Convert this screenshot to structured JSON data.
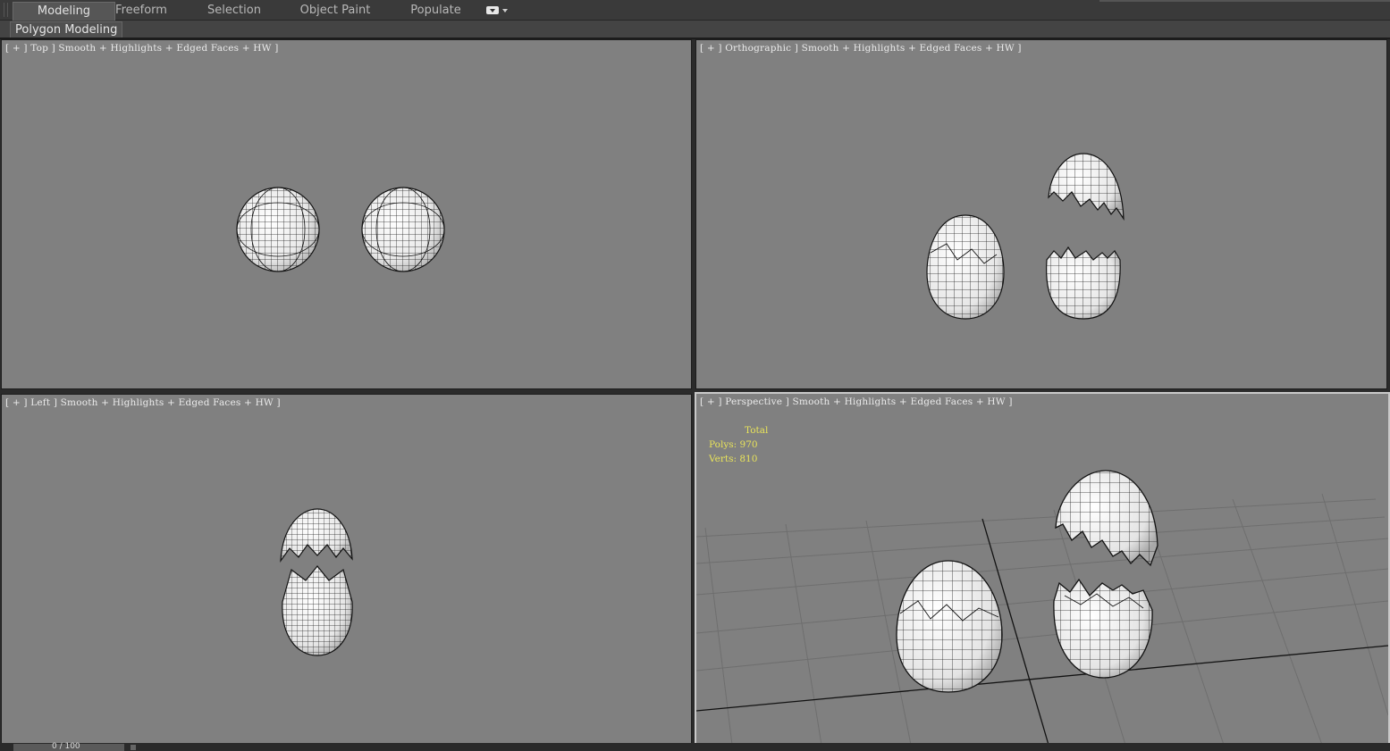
{
  "ribbon": {
    "tabs": [
      {
        "label": "Modeling",
        "active": true
      },
      {
        "label": "Freeform",
        "active": false
      },
      {
        "label": "Selection",
        "active": false
      },
      {
        "label": "Object Paint",
        "active": false
      },
      {
        "label": "Populate",
        "active": false
      }
    ],
    "dropdown_icon": "panel-dropdown-icon",
    "panel_label": "Polygon Modeling"
  },
  "viewports": {
    "top": {
      "label": "[ + ] Top ] Smooth + Highlights + Edged Faces + HW ]"
    },
    "ortho": {
      "label": "[ + ] Orthographic ] Smooth + Highlights + Edged Faces + HW ]"
    },
    "left": {
      "label": "[ + ] Left ] Smooth + Highlights + Edged Faces + HW ]"
    },
    "persp": {
      "label": "[ + ] Perspective ] Smooth + Highlights + Edged Faces + HW ]"
    }
  },
  "stats": {
    "header": "Total",
    "polys": "Polys: 970",
    "verts": "Verts: 810"
  },
  "timeline": {
    "frame": "0 / 100"
  },
  "colors": {
    "viewport_bg": "#808080",
    "stats_text": "#e8e35a",
    "ui_dark": "#3a3a3a"
  }
}
